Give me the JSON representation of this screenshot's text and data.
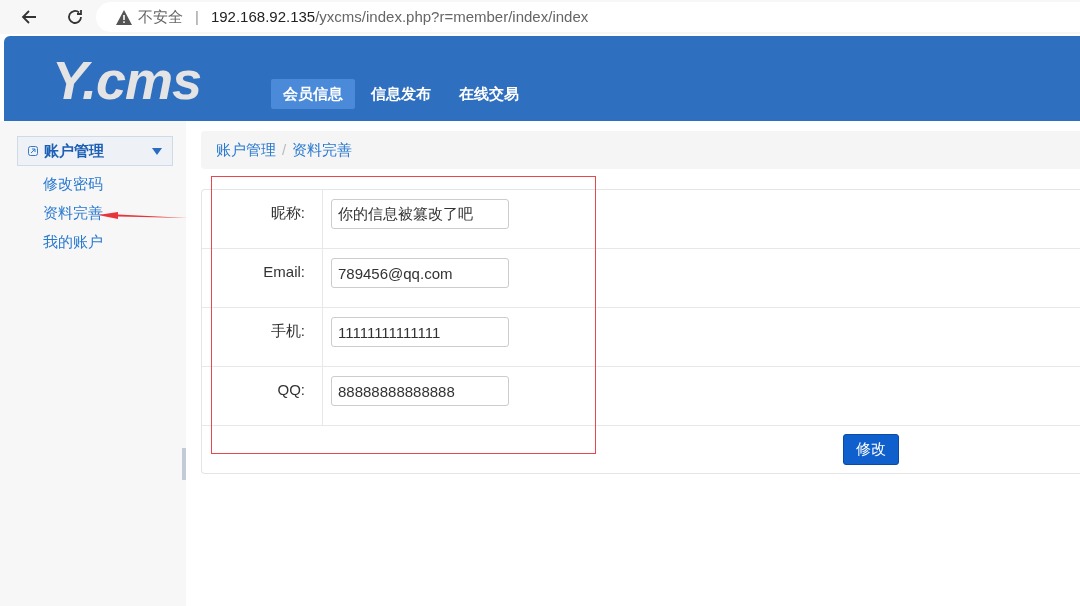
{
  "browser": {
    "security_label": "不安全",
    "separator": "|",
    "url_host": "192.168.92.135",
    "url_path": "/yxcms/index.php?r=member/index/index"
  },
  "header": {
    "logo": "Y.cms",
    "nav": [
      {
        "label": "会员信息",
        "selected": true
      },
      {
        "label": "信息发布",
        "selected": false
      },
      {
        "label": "在线交易",
        "selected": false
      }
    ]
  },
  "sidebar": {
    "group": {
      "label": "账户管理",
      "expanded": true
    },
    "items": [
      {
        "label": "修改密码"
      },
      {
        "label": "资料完善"
      },
      {
        "label": "我的账户"
      }
    ]
  },
  "breadcrumb": {
    "items": [
      "账户管理",
      "资料完善"
    ],
    "separator": "/"
  },
  "form": {
    "fields": [
      {
        "label": "昵称:",
        "value": "你的信息被篡改了吧"
      },
      {
        "label": "Email:",
        "value": "789456@qq.com"
      },
      {
        "label": "手机:",
        "value": "11111111111111"
      },
      {
        "label": "QQ:",
        "value": "88888888888888"
      }
    ],
    "submit": "修改"
  }
}
